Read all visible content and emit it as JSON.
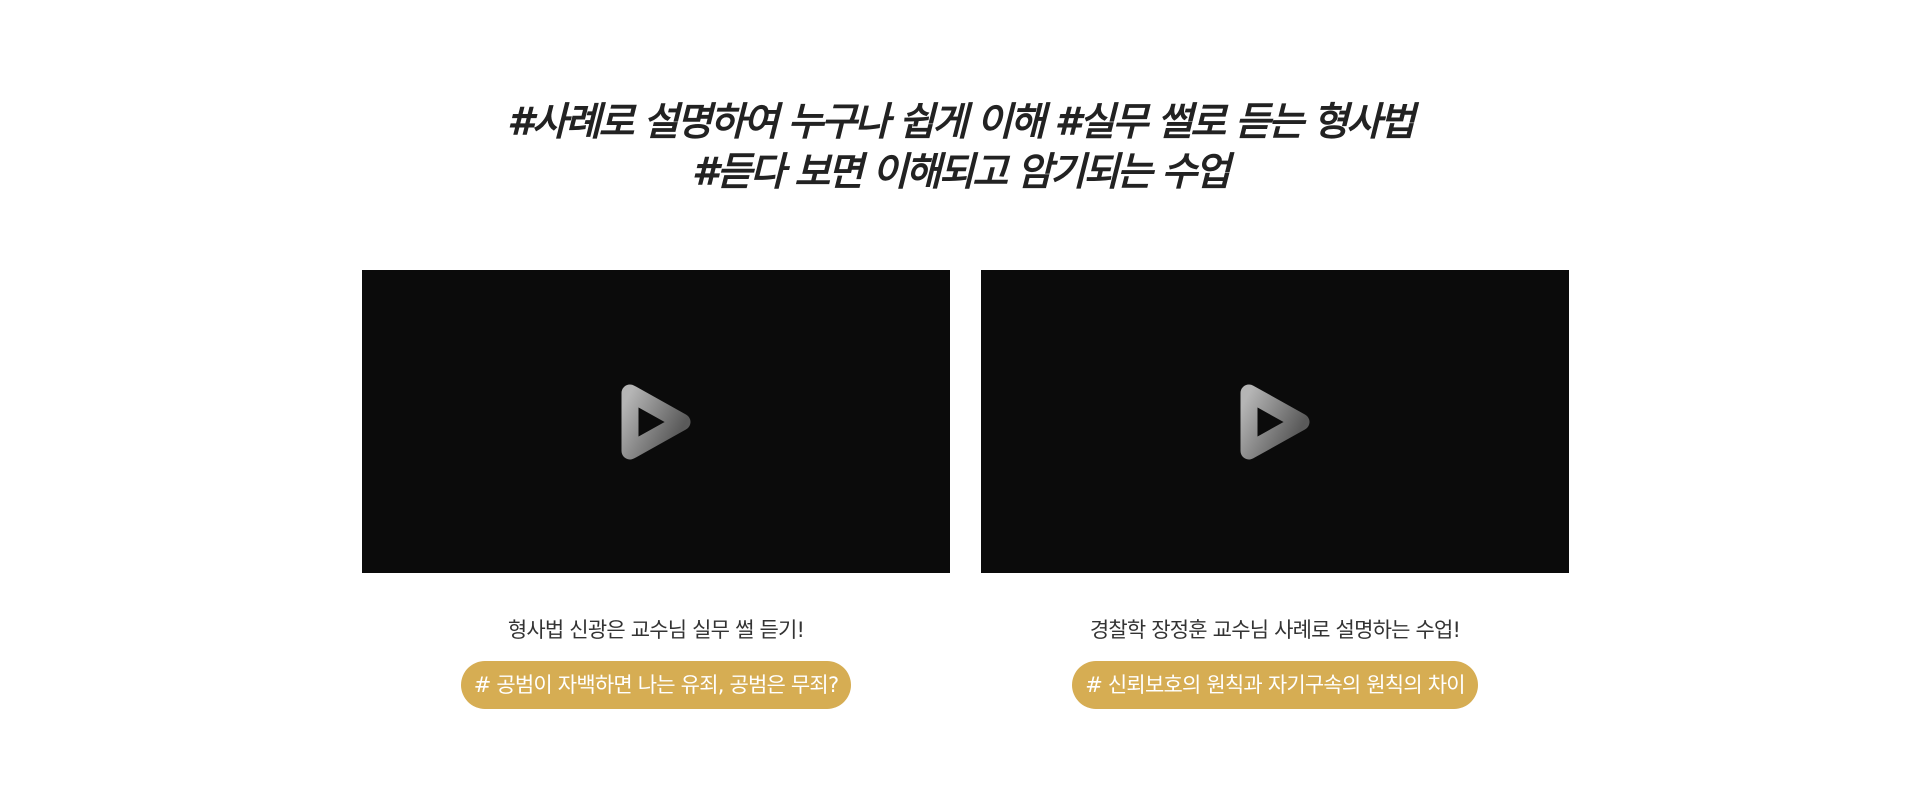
{
  "headline": {
    "line1": "#사례로 설명하여 누구나 쉽게 이해 #실무 썰로 듣는 형사법",
    "line2": "#듣다 보면 이해되고 암기되는 수업"
  },
  "videos": [
    {
      "caption": "형사법 신광은 교수님 실무 썰 듣기!",
      "tag": "# 공범이 자백하면 나는 유죄, 공범은 무죄?"
    },
    {
      "caption": "경찰학 장정훈 교수님 사례로 설명하는 수업!",
      "tag": "# 신뢰보호의 원칙과 자기구속의 원칙의 차이"
    }
  ],
  "colors": {
    "player_bg": "#0b0b0b",
    "tag_bg": "#d6ad53",
    "headline_text": "#222222"
  },
  "icons": {
    "play": "play-icon"
  }
}
